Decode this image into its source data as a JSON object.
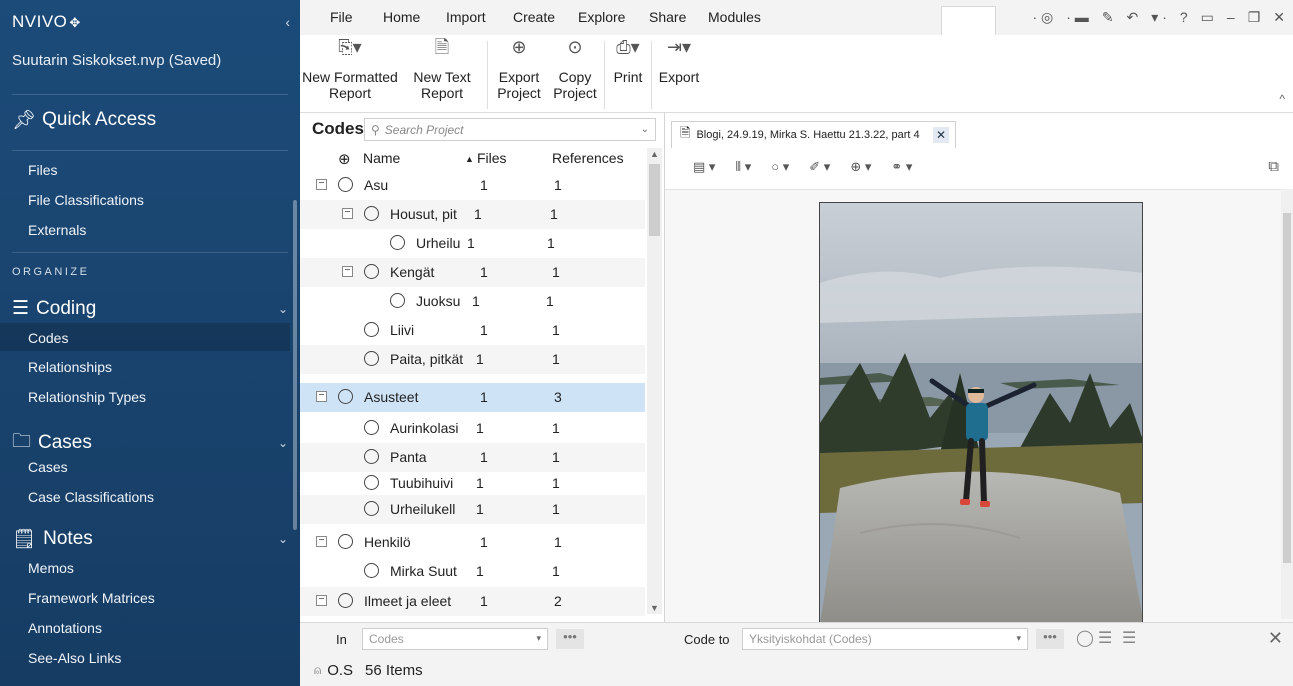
{
  "sidebar": {
    "brand": "NVIVO",
    "project": "Suutarin Siskokset.nvp (Saved)",
    "quick_access": "Quick Access",
    "files": "Files",
    "file_classifications": "File Classifications",
    "externals": "Externals",
    "organize": "ORGANIZE",
    "coding": "Coding",
    "codes": "Codes",
    "relationships": "Relationships",
    "relationship_types": "Relationship Types",
    "cases": "Cases",
    "cases_item": "Cases",
    "case_classifications": "Case Classifications",
    "notes": "Notes",
    "memos": "Memos",
    "framework_matrices": "Framework Matrices",
    "annotations": "Annotations",
    "see_also_links": "See-Also Links"
  },
  "menu": {
    "file": "File",
    "home": "Home",
    "import": "Import",
    "create": "Create",
    "explore": "Explore",
    "share": "Share",
    "modules": "Modules"
  },
  "ribbon": {
    "new_formatted_report_1": "New Formatted",
    "new_formatted_report_2": "Report",
    "new_text_report_1": "New Text",
    "new_text_report_2": "Report",
    "export_project_1": "Export",
    "export_project_2": "Project",
    "copy_project_1": "Copy",
    "copy_project_2": "Project",
    "print": "Print",
    "export": "Export"
  },
  "codes_pane": {
    "title": "Codes",
    "search_placeholder": "Search Project",
    "col_name": "Name",
    "col_files": "Files",
    "col_references": "References",
    "rows": [
      {
        "name": "Asu",
        "files": "1",
        "refs": "1"
      },
      {
        "name": "Housut, pit",
        "files": "1",
        "refs": "1"
      },
      {
        "name": "Urheilu",
        "files": "1",
        "refs": "1"
      },
      {
        "name": "Kengät",
        "files": "1",
        "refs": "1"
      },
      {
        "name": "Juoksu",
        "files": "1",
        "refs": "1"
      },
      {
        "name": "Liivi",
        "files": "1",
        "refs": "1"
      },
      {
        "name": "Paita, pitkät",
        "files": "1",
        "refs": "1"
      },
      {
        "name": "Asusteet",
        "files": "1",
        "refs": "3"
      },
      {
        "name": "Aurinkolasi",
        "files": "1",
        "refs": "1"
      },
      {
        "name": "Panta",
        "files": "1",
        "refs": "1"
      },
      {
        "name": "Tuubihuivi",
        "files": "1",
        "refs": "1"
      },
      {
        "name": "Urheilukell",
        "files": "1",
        "refs": "1"
      },
      {
        "name": "Henkilö",
        "files": "1",
        "refs": "1"
      },
      {
        "name": "Mirka Suut",
        "files": "1",
        "refs": "1"
      },
      {
        "name": "Ilmeet ja eleet",
        "files": "1",
        "refs": "2"
      }
    ]
  },
  "document": {
    "tab_title": "Blogi, 24.9.19, Mirka S. Haettu 21.3.22, part 4"
  },
  "bottom": {
    "in_label": "In",
    "in_value": "Codes",
    "code_to_label": "Code to",
    "code_to_value": "Yksityiskohdat (Codes)",
    "dots": "•••"
  },
  "status": {
    "user": "O.S",
    "items": "56 Items"
  },
  "colors": {
    "sidebar": "#1c4b79",
    "selected_row": "#cfe3f7"
  }
}
